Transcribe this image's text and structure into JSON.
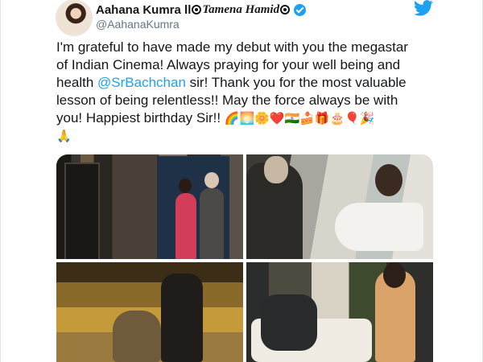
{
  "profile": {
    "display_name": "Aahana Kumra ll",
    "display_name_alt": "Tamena Hamid",
    "handle": "@AahanaKumra",
    "avatar_icon": "profile-photo",
    "verified_icon": "verified-badge-icon",
    "decoration_icon": "wheel-symbol-icon"
  },
  "brand": {
    "icon": "twitter-bird-icon",
    "color": "#1da1f2"
  },
  "tweet": {
    "line_1": "I'm grateful to have made my debut with you the megastar",
    "line_2": "of Indian Cinema! Always praying for your well being and",
    "line_3_pre": "health ",
    "mention": "@SrBachchan",
    "line_3_post": " sir! Thank you for the most valuable",
    "line_4": "lesson of being relentless!! May the force always be with",
    "line_5": "you! Happiest birthday Sir!! ",
    "line_5_emojis": "🌈🌅🌼❤️🇮🇳🍰🎁🎂🎈🎉",
    "line_6_emojis": "🙏"
  },
  "media": [
    {
      "name": "photo-hallway-couple"
    },
    {
      "name": "photo-hospital-scene"
    },
    {
      "name": "photo-night-bench"
    },
    {
      "name": "photo-sofa-conversation"
    }
  ],
  "colors": {
    "text": "#14171a",
    "muted": "#657786",
    "link": "#1da1f2"
  }
}
